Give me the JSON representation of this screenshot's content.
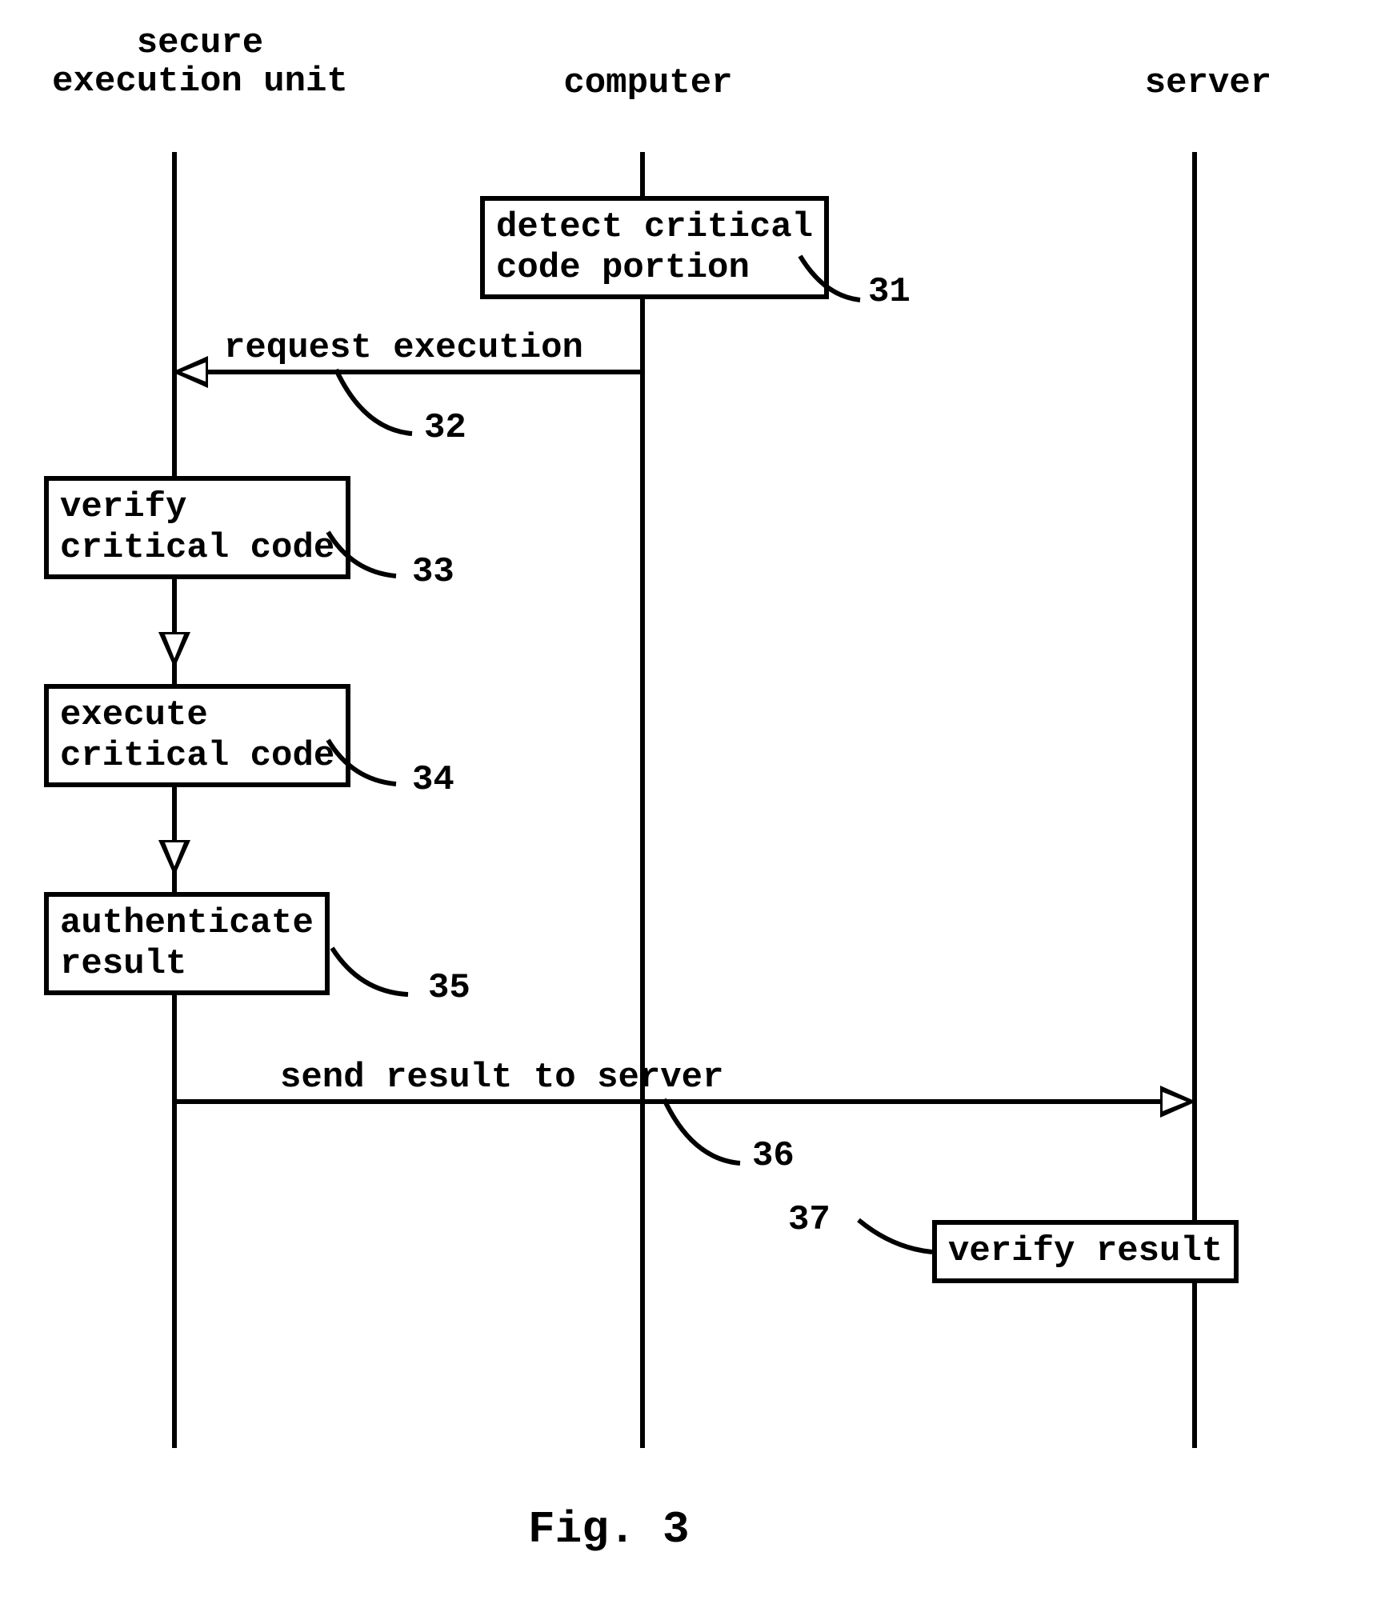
{
  "figure_label": "Fig. 3",
  "lanes": {
    "secure": "secure\nexecution unit",
    "computer": "computer",
    "server": "server"
  },
  "boxes": {
    "detect": "detect critical\ncode portion",
    "verify_code": "verify\ncritical code",
    "execute_code": "execute\ncritical code",
    "authenticate": "authenticate\nresult",
    "verify_result": "verify result"
  },
  "arrows": {
    "request_execution": "request execution",
    "send_result": "send result to server"
  },
  "refs": {
    "r31": "31",
    "r32": "32",
    "r33": "33",
    "r34": "34",
    "r35": "35",
    "r36": "36",
    "r37": "37"
  }
}
